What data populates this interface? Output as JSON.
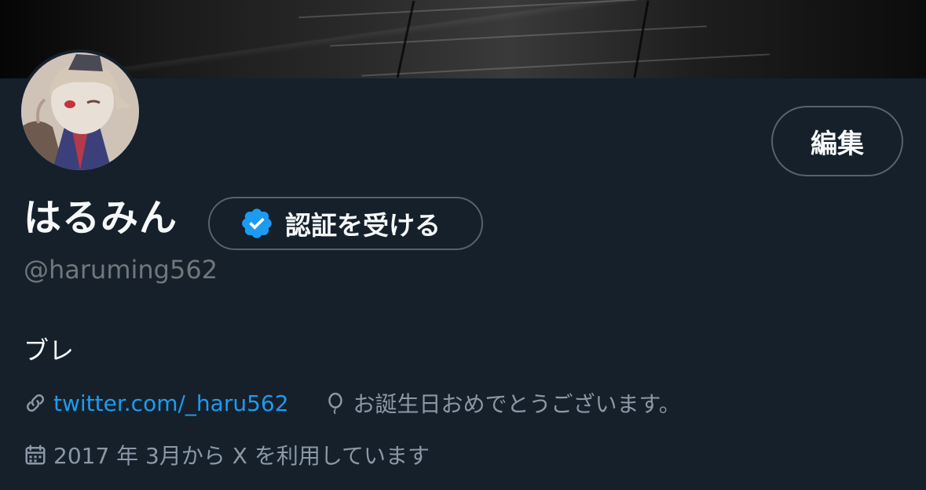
{
  "profile": {
    "display_name": "はるみん",
    "handle": "@haruming562",
    "bio": "ブレ",
    "website": "twitter.com/_haru562",
    "birthday_text": "お誕生日おめでとうございます。",
    "joined_text": "2017 年 3月から X を利用しています"
  },
  "buttons": {
    "edit_label": "編集",
    "verify_label": "認証を受ける"
  },
  "colors": {
    "background": "#15202b",
    "link": "#1d9bf0",
    "verified_badge": "#1d9bf0",
    "muted_text": "#71767b",
    "border": "#536471"
  },
  "icons": {
    "verified": "verified-badge-icon",
    "link": "link-icon",
    "birthday": "balloon-icon",
    "joined": "calendar-icon"
  }
}
